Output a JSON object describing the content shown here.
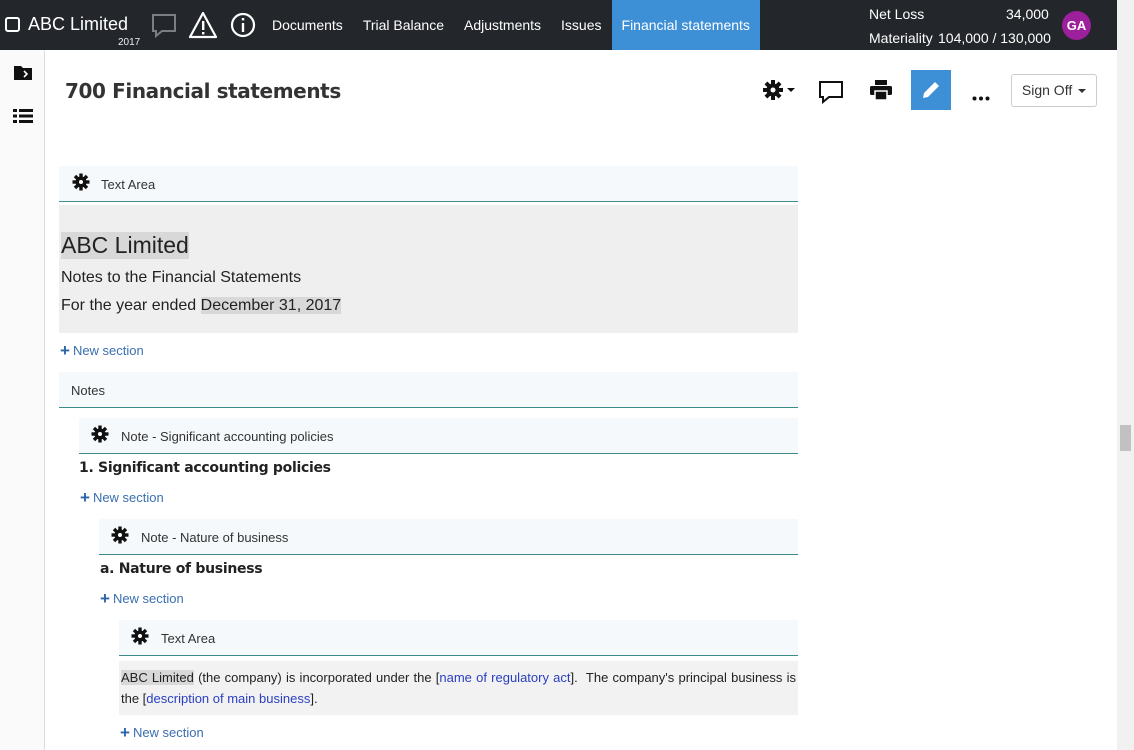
{
  "app": {
    "client_name": "ABC Limited",
    "year": "2017"
  },
  "nav": {
    "items": [
      {
        "label": "Documents"
      },
      {
        "label": "Trial Balance"
      },
      {
        "label": "Adjustments"
      },
      {
        "label": "Issues"
      },
      {
        "label": "Financial statements",
        "active": true
      }
    ]
  },
  "kpis": {
    "net_loss_label": "Net Loss",
    "net_loss_value": "34,000",
    "materiality_label": "Materiality",
    "materiality_value": "104,000 / 130,000"
  },
  "user": {
    "initials": "GA",
    "avatar_color": "#9c1f9c"
  },
  "page": {
    "title": "700 Financial statements",
    "sign_off_label": "Sign Off"
  },
  "sections": {
    "text_area_1": {
      "label": "Text Area",
      "company": "ABC Limited",
      "subtitle": "Notes to the Financial Statements",
      "period_prefix": "For the year ended ",
      "period_date": "December 31, 2017"
    },
    "new_section_label": "New section",
    "notes": {
      "label": "Notes"
    },
    "note_policies": {
      "label": "Note - Significant accounting policies",
      "heading": "1. Significant accounting policies"
    },
    "note_business": {
      "label": "Note - Nature of business",
      "heading": "a. Nature of business"
    },
    "text_area_2": {
      "label": "Text Area",
      "company": "ABC Limited",
      "text_1": " (the company) is incorporated under the [",
      "link_1": "name of regulatory act",
      "text_2": "].  The company's principal business is the [",
      "link_2": "description of main business",
      "text_3": "]."
    }
  },
  "colors": {
    "topbar": "#23262a",
    "accent": "#3d8fd6",
    "section_rule": "#3e8c8a"
  }
}
